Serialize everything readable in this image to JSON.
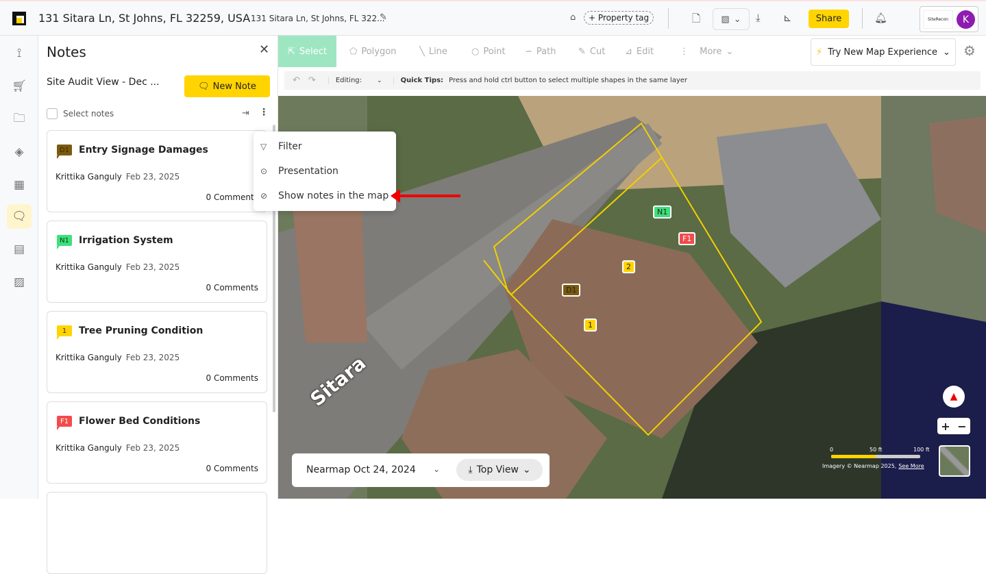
{
  "header": {
    "title": "131 Sitara Ln, St Johns, FL 32259, USA",
    "subtitle": "131 Sitara Ln, St Johns, FL 322...",
    "property_tag": "+ Property tag",
    "share": "Share",
    "brand": "SiteRecon",
    "avatar": "K"
  },
  "rail": {
    "icons": [
      "measure-icon",
      "cart-icon",
      "folder-icon",
      "layers-icon",
      "calculator-icon",
      "notes-icon",
      "report-icon",
      "image-icon"
    ],
    "active": 5
  },
  "notes": {
    "title": "Notes",
    "view": "Site Audit View - Dec ...",
    "new_note": "New Note",
    "select_notes": "Select notes",
    "cards": [
      {
        "badge": "D1",
        "badge_color": "#7a5a10",
        "badge_text": "#3a2a00",
        "title": "Entry Signage Damages",
        "author": "Krittika Ganguly",
        "date": "Feb 23, 2025",
        "comments": "0 Comments"
      },
      {
        "badge": "N1",
        "badge_color": "#3ee07a",
        "badge_text": "#0a3a1a",
        "title": "Irrigation System",
        "author": "Krittika Ganguly",
        "date": "Feb 23, 2025",
        "comments": "0 Comments"
      },
      {
        "badge": "1",
        "badge_color": "#ffd400",
        "badge_text": "#333",
        "title": "Tree Pruning Condition",
        "author": "Krittika Ganguly",
        "date": "Feb 23, 2025",
        "comments": "0 Comments"
      },
      {
        "badge": "F1",
        "badge_color": "#f24b4b",
        "badge_text": "#fff",
        "title": "Flower Bed Conditions",
        "author": "Krittika Ganguly",
        "date": "Feb 23, 2025",
        "comments": "0 Comments"
      }
    ]
  },
  "menu": {
    "items": [
      "Filter",
      "Presentation",
      "Show notes in the map"
    ]
  },
  "toolbar": {
    "tools": [
      "Select",
      "Polygon",
      "Line",
      "Point",
      "Path",
      "Cut",
      "Edit",
      "More"
    ],
    "try_new": "Try New Map Experience",
    "editing": "Editing:",
    "tips_label": "Quick Tips:",
    "tips": "Press and hold ctrl button to select multiple shapes in the same layer"
  },
  "map": {
    "imagery": "Nearmap Oct 24, 2024",
    "view": "Top View",
    "street": "Sitara",
    "scale": [
      "0",
      "50 ft",
      "100 ft"
    ],
    "attribution": "Imagery © Nearmap 2025,",
    "see_more": "See More",
    "pins": [
      "N1",
      "F1",
      "2",
      "D1",
      "1"
    ]
  }
}
